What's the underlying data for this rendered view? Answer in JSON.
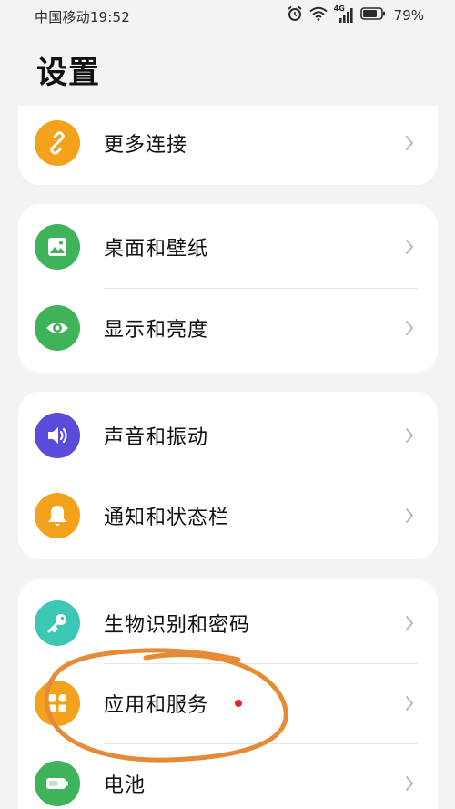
{
  "status_bar": {
    "carrier": "中国移动",
    "time": "19:52",
    "network": "4G",
    "battery": "79%",
    "battery_fraction": 0.79
  },
  "title": "设置",
  "colors": {
    "orange": "#f4a21b",
    "green": "#3fb35a",
    "purple": "#5b4bdb",
    "teal": "#3cc6b4",
    "annotation": "#e58a35"
  },
  "sections": {
    "connect": {
      "more_connect": {
        "label": "更多连接",
        "icon": "link-icon"
      }
    },
    "display": {
      "wallpaper": {
        "label": "桌面和壁纸",
        "icon": "image-icon"
      },
      "brightness": {
        "label": "显示和亮度",
        "icon": "eye-icon"
      }
    },
    "sound": {
      "sound_vibration": {
        "label": "声音和振动",
        "icon": "speaker-icon"
      },
      "notifications": {
        "label": "通知和状态栏",
        "icon": "bell-icon"
      }
    },
    "security": {
      "biometrics": {
        "label": "生物识别和密码",
        "icon": "key-icon"
      },
      "apps": {
        "label": "应用和服务",
        "icon": "apps-grid-icon",
        "badge": "red-dot"
      },
      "battery": {
        "label": "电池",
        "icon": "battery-icon"
      }
    }
  }
}
